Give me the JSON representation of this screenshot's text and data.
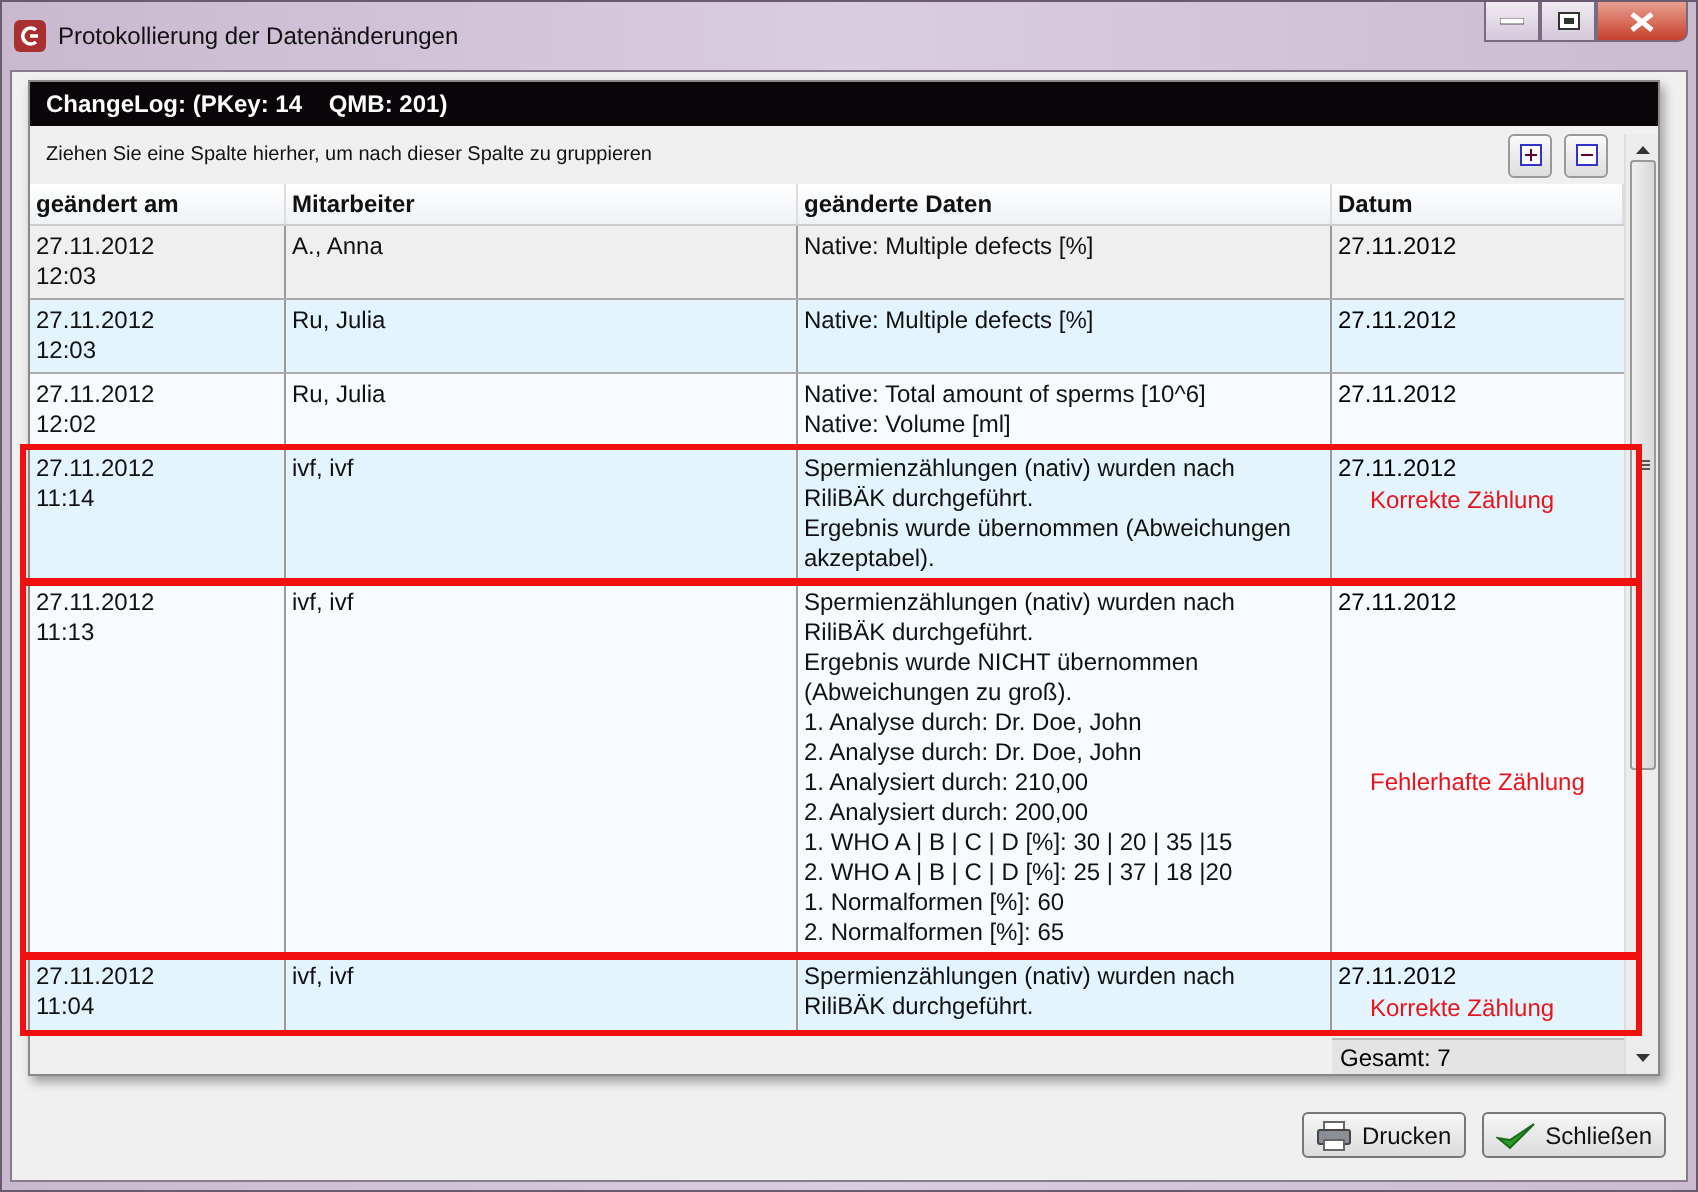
{
  "window": {
    "title": "Protokollierung der Datenänderungen"
  },
  "panel": {
    "title": "ChangeLog: (PKey: 14    QMB: 201)",
    "group_hint": "Ziehen Sie eine Spalte hierher, um nach dieser Spalte zu gruppieren"
  },
  "table": {
    "columns": [
      "geändert am",
      "Mitarbeiter",
      "geänderte Daten",
      "Datum"
    ],
    "rows": [
      {
        "changed_at": [
          "27.11.2012",
          "12:03"
        ],
        "employee": "A., Anna",
        "data": [
          "Native: Multiple defects [%]"
        ],
        "date": "27.11.2012",
        "selected": true,
        "highlighted": false
      },
      {
        "changed_at": [
          "27.11.2012",
          "12:03"
        ],
        "employee": "Ru, Julia",
        "data": [
          "Native: Multiple defects [%]"
        ],
        "date": "27.11.2012",
        "selected": false,
        "highlighted": false
      },
      {
        "changed_at": [
          "27.11.2012",
          "12:02"
        ],
        "employee": "Ru, Julia",
        "data": [
          "Native: Total amount of sperms [10^6]",
          "Native: Volume [ml]"
        ],
        "date": "27.11.2012",
        "selected": false,
        "highlighted": false
      },
      {
        "changed_at": [
          "27.11.2012",
          "11:14"
        ],
        "employee": "ivf, ivf",
        "data": [
          "Spermienzählungen (nativ) wurden nach",
          "RiliBÄK durchgeführt.",
          "Ergebnis wurde übernommen (Abweichungen",
          "akzeptabel)."
        ],
        "date": "27.11.2012",
        "note": "Korrekte Zählung",
        "selected": false,
        "highlighted": true
      },
      {
        "changed_at": [
          "27.11.2012",
          "11:13"
        ],
        "employee": "ivf, ivf",
        "data": [
          "Spermienzählungen (nativ) wurden nach",
          "RiliBÄK durchgeführt.",
          "Ergebnis wurde NICHT übernommen",
          "(Abweichungen zu groß).",
          "1. Analyse durch: Dr. Doe, John",
          "2. Analyse durch: Dr. Doe, John",
          "1. Analysiert durch: 210,00",
          "2. Analysiert durch: 200,00",
          "1. WHO A | B | C | D [%]: 30 | 20 | 35 |15",
          "2. WHO A | B | C | D [%]: 25 | 37 | 18 |20",
          "1. Normalformen [%]: 60",
          "2. Normalformen [%]: 65"
        ],
        "date": "27.11.2012",
        "note": "Fehlerhafte Zählung",
        "selected": false,
        "highlighted": true
      },
      {
        "changed_at": [
          "27.11.2012",
          "11:04"
        ],
        "employee": "ivf, ivf",
        "data": [
          "Spermienzählungen (nativ) wurden nach",
          "RiliBÄK durchgeführt."
        ],
        "date": "27.11.2012",
        "note": "Korrekte Zählung",
        "selected": false,
        "highlighted": true
      }
    ],
    "total": "Gesamt: 7"
  },
  "buttons": [
    {
      "kind": "print",
      "label": "Drucken"
    },
    {
      "kind": "confirm",
      "label": "Schließen"
    }
  ]
}
